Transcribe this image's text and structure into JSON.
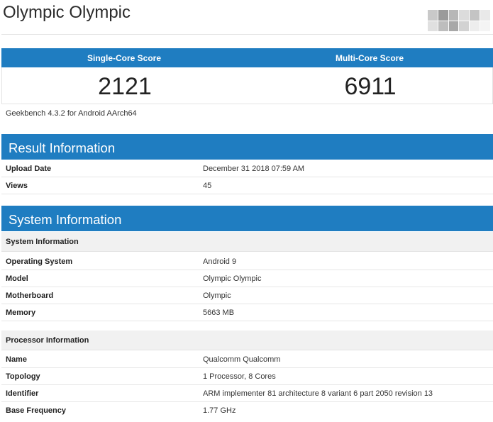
{
  "page_title": "Olympic Olympic",
  "scores": {
    "single_label": "Single-Core Score",
    "multi_label": "Multi-Core Score",
    "single_value": "2121",
    "multi_value": "6911"
  },
  "version_text": "Geekbench 4.3.2 for Android AArch64",
  "result_info": {
    "heading": "Result Information",
    "rows": [
      {
        "key": "Upload Date",
        "value": "December 31 2018 07:59 AM"
      },
      {
        "key": "Views",
        "value": "45"
      }
    ]
  },
  "system_info": {
    "heading": "System Information",
    "sub1": "System Information",
    "rows1": [
      {
        "key": "Operating System",
        "value": "Android 9"
      },
      {
        "key": "Model",
        "value": "Olympic Olympic"
      },
      {
        "key": "Motherboard",
        "value": "Olympic"
      },
      {
        "key": "Memory",
        "value": "5663 MB"
      }
    ],
    "sub2": "Processor Information",
    "rows2": [
      {
        "key": "Name",
        "value": "Qualcomm Qualcomm"
      },
      {
        "key": "Topology",
        "value": "1 Processor, 8 Cores"
      },
      {
        "key": "Identifier",
        "value": "ARM implementer 81 architecture 8 variant 6 part 2050 revision 13"
      },
      {
        "key": "Base Frequency",
        "value": "1.77 GHz"
      }
    ]
  },
  "colors": {
    "accent": "#1f7dc1",
    "subhead_bg": "#f1f1f1"
  }
}
